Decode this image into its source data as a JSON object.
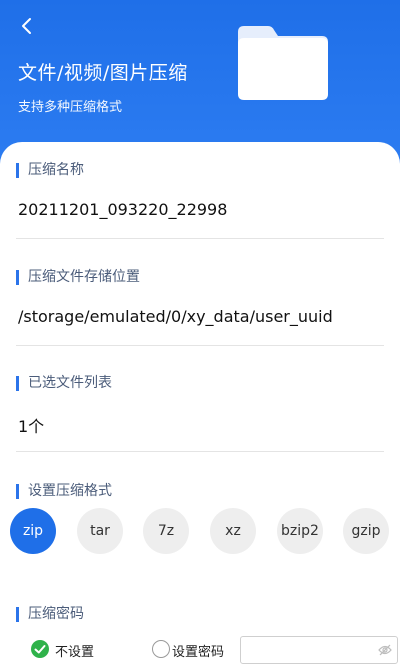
{
  "header": {
    "title": "文件/视频/图片压缩",
    "subtitle": "支持多种压缩格式",
    "back_icon": "chevron-left-icon",
    "illustration_icon": "folder-icon",
    "background_color": "#1f6fe8"
  },
  "sections": {
    "name": {
      "label": "压缩名称",
      "value": "20211201_093220_22998"
    },
    "location": {
      "label": "压缩文件存储位置",
      "value": "/storage/emulated/0/xy_data/user_uuid"
    },
    "files": {
      "label": "已选文件列表",
      "value": "1个"
    },
    "format": {
      "label": "设置压缩格式",
      "options": [
        "zip",
        "tar",
        "7z",
        "xz",
        "bzip2",
        "gzip"
      ],
      "selected": "zip"
    },
    "password": {
      "label": "压缩密码",
      "option_none": "不设置",
      "option_set": "设置密码",
      "selected": "不设置",
      "input_placeholder": "",
      "toggle_icon": "eye-off-icon"
    }
  },
  "colors": {
    "accent": "#1f6fe8",
    "check": "#2fb24a"
  }
}
